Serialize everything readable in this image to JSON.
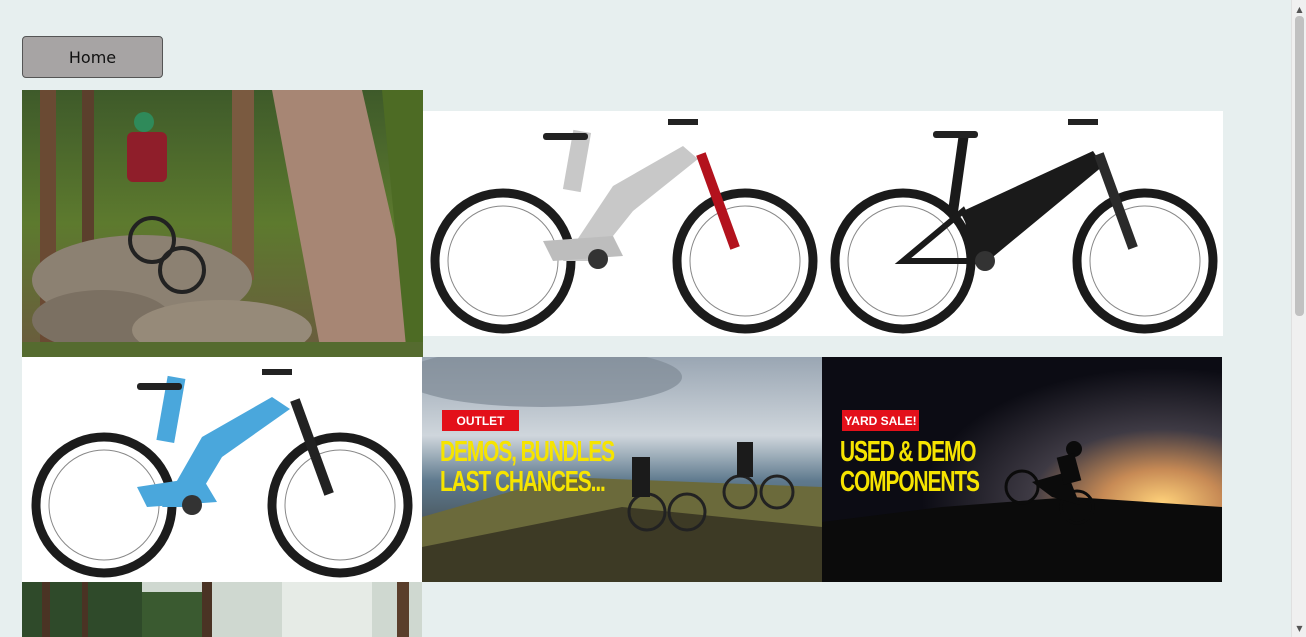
{
  "nav": {
    "home_label": "Home"
  },
  "tiles": {
    "outlet": {
      "tag": "OUTLET",
      "line1": "DEMOS, BUNDLES",
      "line2": "LAST CHANCES..."
    },
    "yard_sale": {
      "tag": "YARD SALE!",
      "line1": "USED & DEMO",
      "line2": "COMPONENTS"
    }
  },
  "colors": {
    "page_background": "#e7efef",
    "button_background": "#a7a4a4",
    "banner_tag": "#e3101a",
    "banner_headline": "#f6e400",
    "bike_silver": "#c8c8c8",
    "bike_black": "#1a1a1a",
    "bike_blue": "#4aa7dc"
  },
  "scrollbar": {
    "up_icon": "triangle-up",
    "down_icon": "triangle-down"
  }
}
